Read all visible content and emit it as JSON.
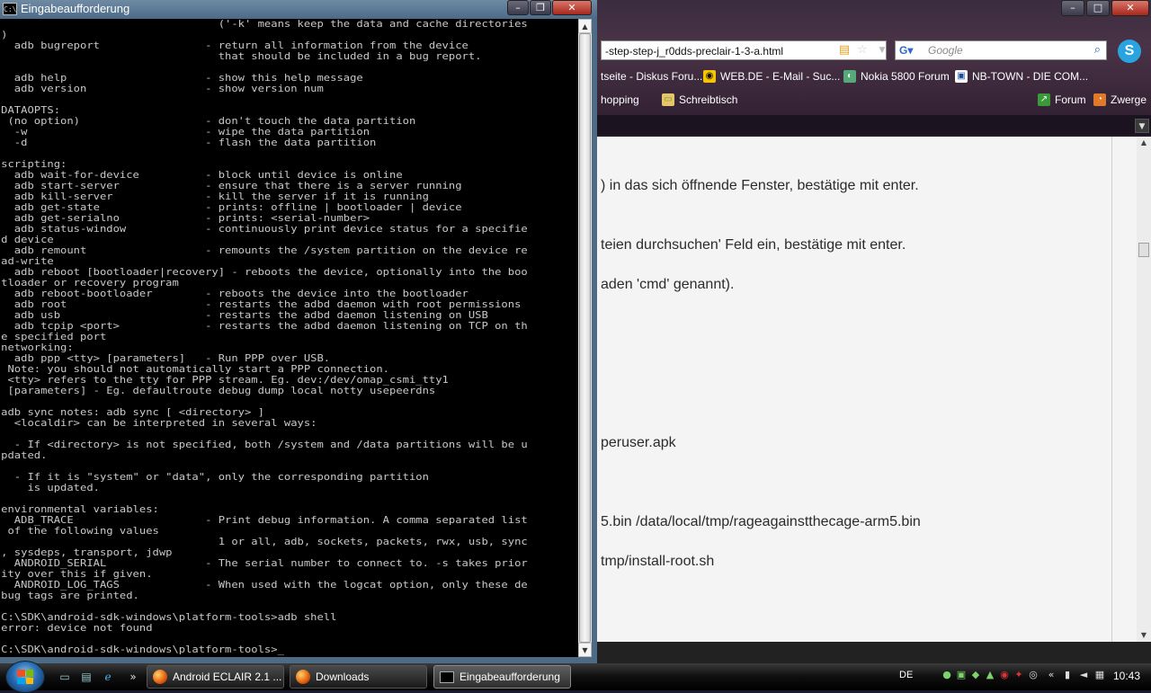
{
  "browser": {
    "url": "-step-step-j_r0dds-preclair-1-3-a.html",
    "search_placeholder": "Google",
    "bookmarks_row1": [
      "tseite - Diskus Foru...",
      "WEB.DE - E-Mail - Suc...",
      "Nokia 5800 Forum",
      "NB-TOWN - DIE COM..."
    ],
    "bookmarks_row2": [
      "hopping",
      "Schreibtisch",
      "Forum",
      "Zwerge"
    ],
    "content_lines": [
      ") in das sich öffnende Fenster, bestätige mit enter.",
      "teien durchsuchen' Feld ein, bestätige mit enter.",
      "aden 'cmd' genannt).",
      "peruser.apk",
      "5.bin /data/local/tmp/rageagainstthecage-arm5.bin",
      "tmp/install-root.sh"
    ],
    "icons": [
      "rss-icon",
      "star-icon",
      "google-icon",
      "skype-icon"
    ]
  },
  "cmd": {
    "title": "Eingabeaufforderung",
    "console_lines": [
      "                                 ('-k' means keep the data and cache directories",
      ")",
      "  adb bugreport                - return all information from the device",
      "                                 that should be included in a bug report.",
      "",
      "  adb help                     - show this help message",
      "  adb version                  - show version num",
      "",
      "DATAOPTS:",
      " (no option)                   - don't touch the data partition",
      "  -w                           - wipe the data partition",
      "  -d                           - flash the data partition",
      "",
      "scripting:",
      "  adb wait-for-device          - block until device is online",
      "  adb start-server             - ensure that there is a server running",
      "  adb kill-server              - kill the server if it is running",
      "  adb get-state                - prints: offline | bootloader | device",
      "  adb get-serialno             - prints: <serial-number>",
      "  adb status-window            - continuously print device status for a specifie",
      "d device",
      "  adb remount                  - remounts the /system partition on the device re",
      "ad-write",
      "  adb reboot [bootloader|recovery] - reboots the device, optionally into the boo",
      "tloader or recovery program",
      "  adb reboot-bootloader        - reboots the device into the bootloader",
      "  adb root                     - restarts the adbd daemon with root permissions",
      "  adb usb                      - restarts the adbd daemon listening on USB",
      "  adb tcpip <port>             - restarts the adbd daemon listening on TCP on th",
      "e specified port",
      "networking:",
      "  adb ppp <tty> [parameters]   - Run PPP over USB.",
      " Note: you should not automatically start a PPP connection.",
      " <tty> refers to the tty for PPP stream. Eg. dev:/dev/omap_csmi_tty1",
      " [parameters] - Eg. defaultroute debug dump local notty usepeerdns",
      "",
      "adb sync notes: adb sync [ <directory> ]",
      "  <localdir> can be interpreted in several ways:",
      "",
      "  - If <directory> is not specified, both /system and /data partitions will be u",
      "pdated.",
      "",
      "  - If it is \"system\" or \"data\", only the corresponding partition",
      "    is updated.",
      "",
      "environmental variables:",
      "  ADB_TRACE                    - Print debug information. A comma separated list",
      " of the following values",
      "                                 1 or all, adb, sockets, packets, rwx, usb, sync",
      ", sysdeps, transport, jdwp",
      "  ANDROID_SERIAL               - The serial number to connect to. -s takes prior",
      "ity over this if given.",
      "  ANDROID_LOG_TAGS             - When used with the logcat option, only these de",
      "bug tags are printed.",
      "",
      "C:\\SDK\\android-sdk-windows\\platform-tools>adb shell",
      "error: device not found",
      "",
      "C:\\SDK\\android-sdk-windows\\platform-tools>_"
    ]
  },
  "taskbar": {
    "buttons": [
      "Android ECLAIR 2.1 ...",
      "Downloads",
      "Eingabeaufforderung"
    ],
    "language": "DE",
    "clock": "10:43"
  }
}
